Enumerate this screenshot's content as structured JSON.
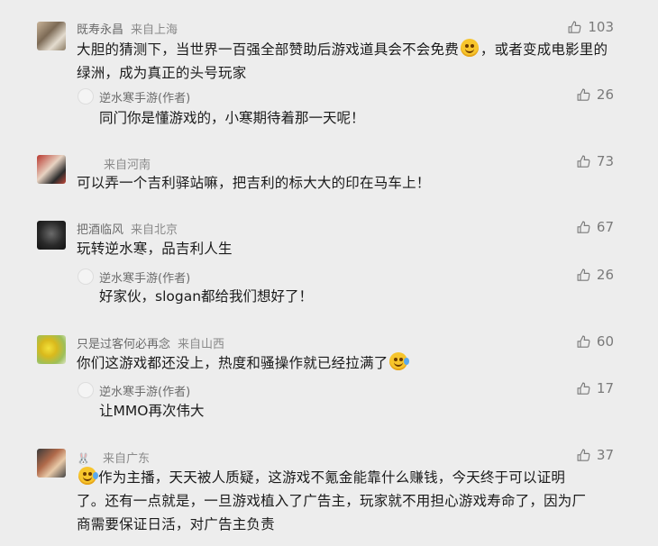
{
  "liked_icon_name": "thumbs-up-outline-icon",
  "colors": {
    "background": "#ededed",
    "meta_text": "#8a8a8a",
    "body_text": "#1a1a1a"
  },
  "comments": [
    {
      "nickname": "既寿永昌",
      "location": "来自上海",
      "text_part1": "大胆的猜测下，当世界一百强全部赞助后游戏道具会不会免费",
      "emoji": "grin-emoji",
      "text_part2": "，或者变成电影里的绿洲，成为真正的头号玩家",
      "likes": "103",
      "reply": {
        "author": "逆水寒手游(作者)",
        "text": "同门你是懂游戏的，小寒期待着那一天呢！",
        "likes": "26"
      }
    },
    {
      "nickname": "",
      "location": "来自河南",
      "text": "可以弄一个吉利驿站嘛，把吉利的标大大的印在马车上！",
      "likes": "73"
    },
    {
      "nickname": "把酒临风",
      "location": "来自北京",
      "text": "玩转逆水寒，品吉利人生",
      "likes": "67",
      "reply": {
        "author": "逆水寒手游(作者)",
        "text": "好家伙，slogan都给我们想好了！",
        "likes": "26"
      }
    },
    {
      "nickname": "只是过客何必再念",
      "location": "来自山西",
      "text": "你们这游戏都还没上，热度和骚操作就已经拉满了",
      "emoji": "laugh-cry-emoji",
      "likes": "60",
      "reply": {
        "author": "逆水寒手游(作者)",
        "text": "让MMO再次伟大",
        "likes": "17"
      }
    },
    {
      "nickname": "",
      "location": "来自广东",
      "badge": "🐰",
      "text_line1": "作为主播，天天被人质疑，这游戏不氪金能靠什么赚钱，今天终于可以证明",
      "text_line2": "了。还有一点就是，一旦游戏植入了广告主，玩家就不用担心游戏寿命了，因为厂",
      "text_line3": "商需要保证日活，对广告主负责",
      "emoji": "crying-emoji",
      "likes": "37"
    }
  ]
}
